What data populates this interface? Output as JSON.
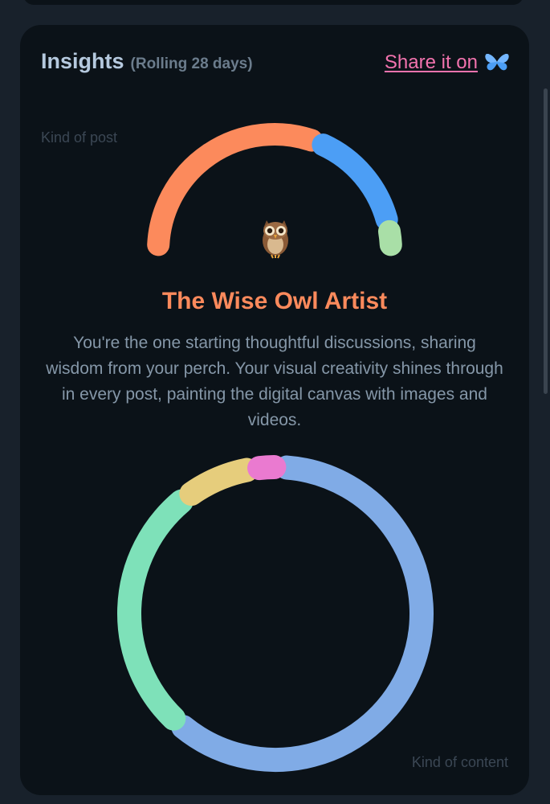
{
  "insights": {
    "title": "Insights",
    "subtitle": "(Rolling 28 days)",
    "share_label": "Share it on",
    "share_icon": "butterfly-icon"
  },
  "post_chart": {
    "label": "Kind of post",
    "persona_icon": "owl-icon"
  },
  "persona": {
    "title": "The Wise Owl Artist",
    "description": "You're the one starting thoughtful discussions, sharing wisdom from your perch. Your visual creativity shines through in every post, painting the digital canvas with images and videos."
  },
  "content_chart": {
    "label": "Kind of content"
  },
  "colors": {
    "accent_orange": "#fc8a5c",
    "link_pink": "#f273ae",
    "gauge_orange": "#fc8a5c",
    "gauge_blue": "#4c9ef5",
    "gauge_green": "#a9dfa7",
    "ring_blue": "#80abe6",
    "ring_green": "#7ee1b9",
    "ring_yellow": "#e6cd7c",
    "ring_pink": "#ea7ad0"
  },
  "chart_data": [
    {
      "type": "gauge",
      "segments": [
        {
          "color": "#fc8a5c",
          "value": 62
        },
        {
          "color": "#4c9ef5",
          "value": 31
        },
        {
          "color": "#a9dfa7",
          "value": 7
        }
      ]
    },
    {
      "type": "pie",
      "segments": [
        {
          "color": "#80abe6",
          "value": 61
        },
        {
          "color": "#7ee1b9",
          "value": 28
        },
        {
          "color": "#e6cd7c",
          "value": 8
        },
        {
          "color": "#ea7ad0",
          "value": 3
        }
      ]
    }
  ]
}
